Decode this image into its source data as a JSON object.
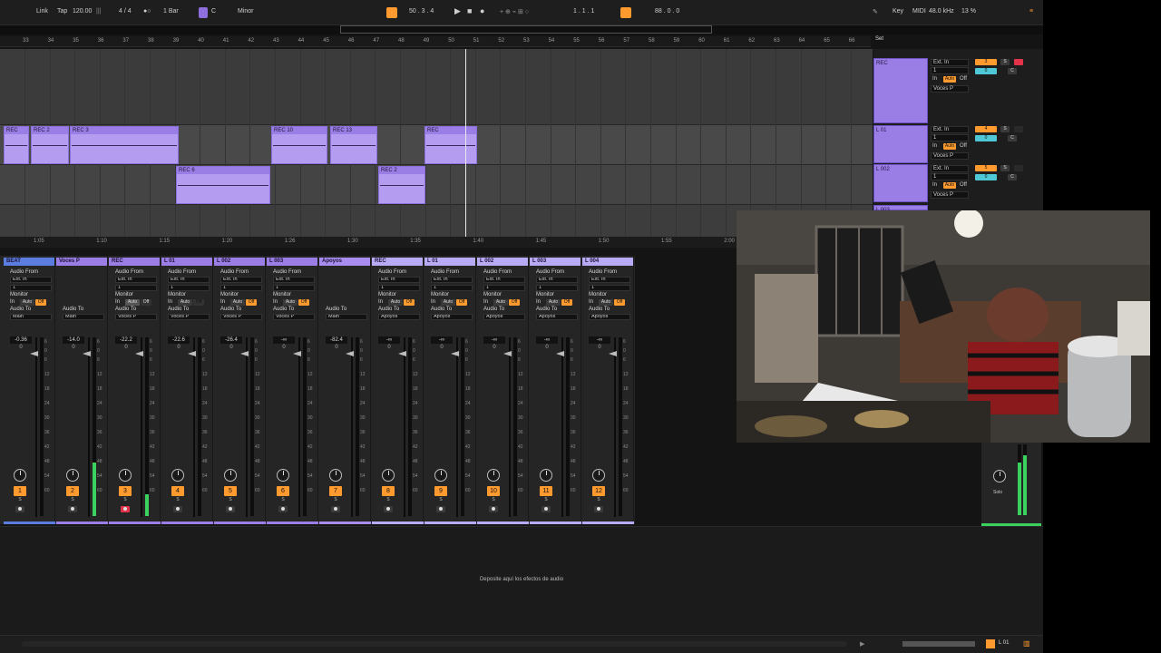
{
  "transport": {
    "link": "Link",
    "tap": "Tap",
    "tempo": "120.00",
    "signature": "4 / 4",
    "quantize": "1 Bar",
    "key": "C",
    "scale": "Minor",
    "position": "50 . 3 . 4",
    "loop_start": "1 . 1 . 1",
    "loop_length": "88 . 0 . 0",
    "key_button": "Key",
    "midi_button": "MIDI",
    "sample_rate": "48.0 kHz",
    "cpu": "13 %"
  },
  "ruler": {
    "bars": [
      "33",
      "34",
      "35",
      "36",
      "37",
      "38",
      "39",
      "40",
      "41",
      "42",
      "43",
      "44",
      "45",
      "46",
      "47",
      "48",
      "49",
      "50",
      "51",
      "52",
      "53",
      "54",
      "55",
      "56",
      "57",
      "58",
      "59",
      "60",
      "61",
      "62",
      "63",
      "64",
      "65",
      "66"
    ],
    "times": [
      "1:05",
      "1:10",
      "1:15",
      "1:20",
      "1:26",
      "1:30",
      "1:35",
      "1:40",
      "1:45",
      "1:50",
      "1:55",
      "2:00"
    ],
    "set_label": "Set"
  },
  "clips": [
    {
      "name": "REC",
      "lane": 1
    },
    {
      "name": "REC 2",
      "lane": 1
    },
    {
      "name": "REC 3",
      "lane": 1
    },
    {
      "name": "REC 10",
      "lane": 1
    },
    {
      "name": "REC 13",
      "lane": 1
    },
    {
      "name": "REC",
      "lane": 1
    },
    {
      "name": "REC 6",
      "lane": 2
    },
    {
      "name": "REC 2",
      "lane": 2
    }
  ],
  "track_headers": [
    {
      "name": "REC",
      "num": "3",
      "ext": "Ext. In",
      "ch": "1",
      "dest": "Voces P"
    },
    {
      "name": "L 01",
      "num": "4",
      "ext": "Ext. In",
      "ch": "1",
      "dest": "Voces P"
    },
    {
      "name": "L 002",
      "num": "5",
      "ext": "Ext. In",
      "ch": "1",
      "dest": "Voces P"
    },
    {
      "name": "L 003",
      "num": "",
      "ext": "",
      "ch": "",
      "dest": ""
    }
  ],
  "header_labels": {
    "in": "In",
    "auto": "Auto",
    "off": "Off",
    "solo": "S",
    "cue": "C",
    "value": "0"
  },
  "strip_labels": {
    "audio_from": "Audio From",
    "monitor": "Monitor",
    "audio_to": "Audio To",
    "in": "In",
    "auto": "Auto",
    "off": "Off",
    "solo": "S"
  },
  "strips": [
    {
      "name": "BEAT",
      "color": "#5b7de0",
      "from": "Ext. In",
      "ch": "1",
      "to": "Main",
      "vol": "-0.36",
      "pan": "0",
      "num": "1",
      "level": 0,
      "group": false
    },
    {
      "name": "Voces P",
      "color": "#9b7de6",
      "from": "",
      "ch": "",
      "to": "Main",
      "vol": "-14.0",
      "pan": "0",
      "num": "2",
      "level": 30,
      "group": true
    },
    {
      "name": "REC",
      "color": "#9b7de6",
      "from": "Ext. In",
      "ch": "1",
      "to": "Voces P",
      "vol": "-22.2",
      "pan": "0",
      "num": "3",
      "level": 12,
      "group": false
    },
    {
      "name": "L 01",
      "color": "#9b7de6",
      "from": "Ext. In",
      "ch": "1",
      "to": "Voces P",
      "vol": "-22.6",
      "pan": "0",
      "num": "4",
      "level": 0,
      "group": false
    },
    {
      "name": "L 002",
      "color": "#9b7de6",
      "from": "Ext. In",
      "ch": "1",
      "to": "Voces P",
      "vol": "-26.4",
      "pan": "0",
      "num": "5",
      "level": 0,
      "group": false
    },
    {
      "name": "L 003",
      "color": "#9b7de6",
      "from": "Ext. In",
      "ch": "1",
      "to": "Voces P",
      "vol": "-∞",
      "pan": "0",
      "num": "6",
      "level": 0,
      "group": false
    },
    {
      "name": "Apoyos",
      "color": "#a98cf0",
      "from": "",
      "ch": "",
      "to": "Main",
      "vol": "-82.4",
      "pan": "0",
      "num": "7",
      "level": 0,
      "group": true
    },
    {
      "name": "REC",
      "color": "#b9aaf6",
      "from": "Ext. In",
      "ch": "1",
      "to": "Apoyos",
      "vol": "-∞",
      "pan": "0",
      "num": "8",
      "level": 0,
      "group": false
    },
    {
      "name": "L 01",
      "color": "#b9aaf6",
      "from": "Ext. In",
      "ch": "1",
      "to": "Apoyos",
      "vol": "-∞",
      "pan": "0",
      "num": "9",
      "level": 0,
      "group": false
    },
    {
      "name": "L 002",
      "color": "#b9aaf6",
      "from": "Ext. In",
      "ch": "1",
      "to": "Apoyos",
      "vol": "-∞",
      "pan": "0",
      "num": "10",
      "level": 0,
      "group": false
    },
    {
      "name": "L 003",
      "color": "#b9aaf6",
      "from": "Ext. In",
      "ch": "1",
      "to": "Apoyos",
      "vol": "-∞",
      "pan": "0",
      "num": "11",
      "level": 0,
      "group": false
    },
    {
      "name": "L 004",
      "color": "#b9aaf6",
      "from": "Ext. In",
      "ch": "1",
      "to": "Apoyos",
      "vol": "-∞",
      "pan": "0",
      "num": "12",
      "level": 0,
      "group": false
    }
  ],
  "meter_scale": [
    "6",
    "0",
    "6",
    "12",
    "18",
    "24",
    "30",
    "36",
    "42",
    "48",
    "54",
    "60"
  ],
  "master": {
    "solo": "Solo"
  },
  "device_drop": "Deposite aquí los efectos de audio",
  "status": {
    "track": "L 01"
  },
  "colors": {
    "accent": "#ff9a2e",
    "clip": "#b49cf0",
    "meter": "#3bd15e",
    "solo_blue": "#4ec7d6"
  }
}
